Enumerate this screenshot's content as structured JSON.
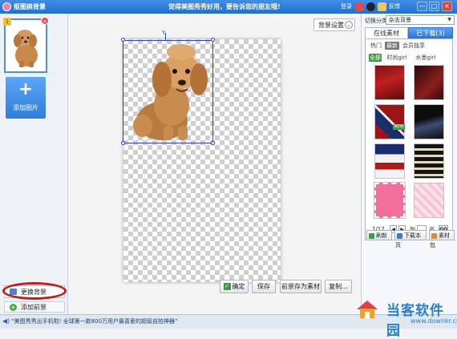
{
  "titlebar": {
    "app_title": "抠图换背景",
    "message": "觉得美图秀秀好用，要告诉您的朋友哦!",
    "login": "登录",
    "feedback": "反馈",
    "min": "—",
    "max": "□",
    "close": "×"
  },
  "left_panel": {
    "thumb_num": "1",
    "add_image": "添加图片",
    "change_bg": "更换背景",
    "add_bg": "添加前景"
  },
  "canvas": {
    "bg_settings": "背景设置",
    "bg_settings_chevron": "⌄",
    "rotate_mark": "Y"
  },
  "buttons": {
    "ok": "确定",
    "save": "保存",
    "save_material": "前景存为素材",
    "copy": "复制..."
  },
  "right_panel": {
    "category_label": "切换分类",
    "category_value": "杂志背景",
    "tab_online": "在线素材",
    "tab_downloaded": "已下载(3)",
    "filter_hot": "热门",
    "filter_new": "最新",
    "filter_member": "会员独享",
    "sub_all": "全部",
    "sub_a": "时尚girl",
    "sub_b": "水墨girl",
    "new_tag": "NEW",
    "pager": {
      "page": "1/12",
      "to": "到",
      "unit": "页",
      "go": "GO"
    },
    "refresh": "刷新",
    "download_page": "下载本页",
    "material_pkg": "素材包"
  },
  "statusbar": {
    "text": "“美图秀秀出手机啦! 全球第一款800万用户最喜爱的超级自拍神器”"
  },
  "watermark": {
    "name": "当客软件园",
    "url": "www.downkr.com"
  },
  "colors": {
    "titlebar": "#1f6fd0",
    "selection": "#2a3ec9",
    "highlight_circle": "#c01d1d",
    "tab_active": "#2a77d6"
  }
}
